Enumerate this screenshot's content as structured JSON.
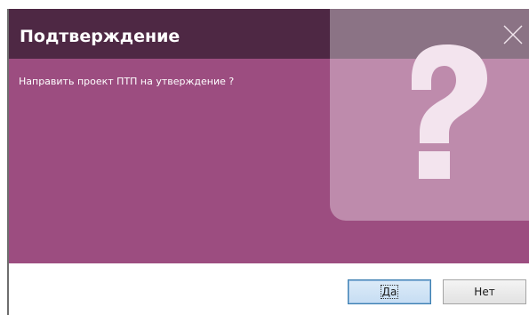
{
  "dialog": {
    "title": "Подтверждение",
    "message": "Направить проект ПТП на утверждение ?",
    "icon": "question-mark-icon",
    "close_icon": "close-icon"
  },
  "buttons": {
    "yes_label": "Да",
    "no_label": "Нет"
  },
  "colors": {
    "header": "#4e2844",
    "content": "#9c4d80",
    "help_panel": "rgba(255,255,255,0.35)",
    "question_mark": "#f3e4ee"
  }
}
